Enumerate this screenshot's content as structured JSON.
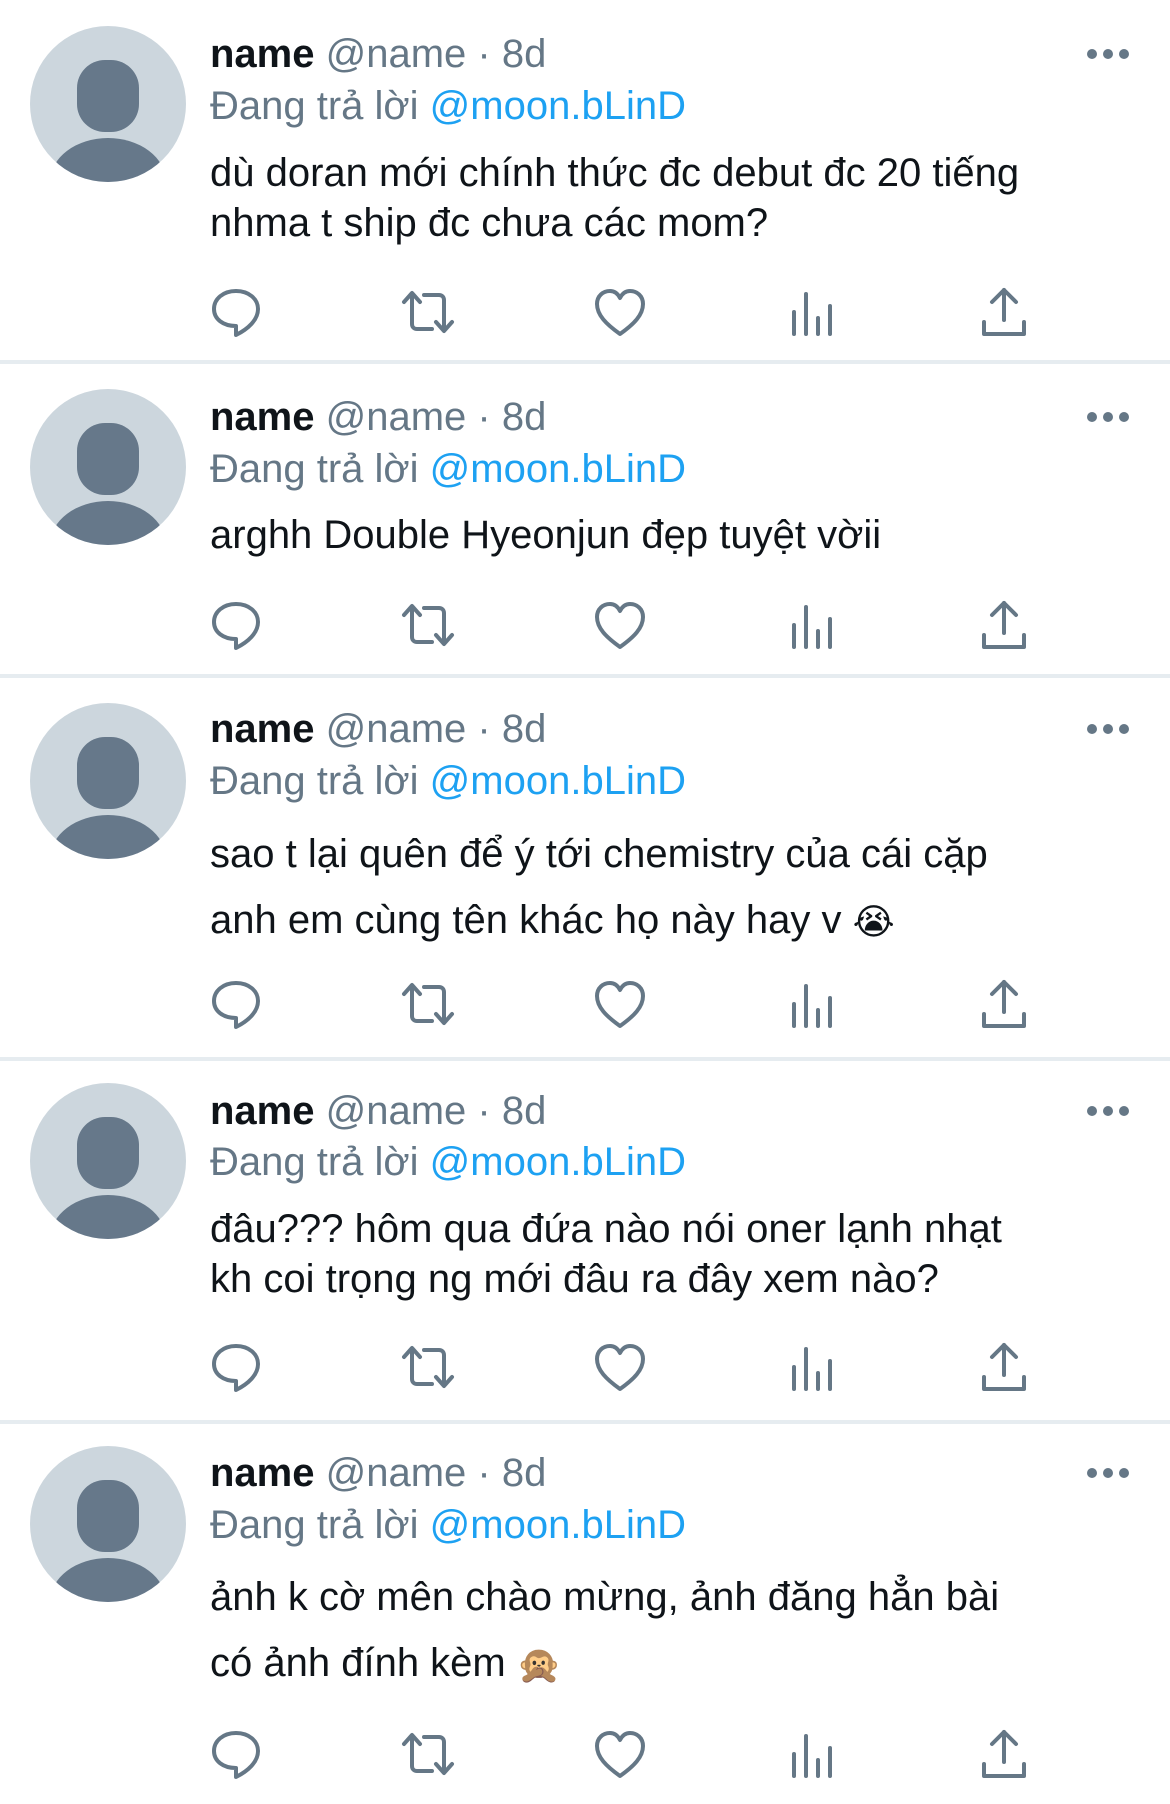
{
  "colors": {
    "text_primary": "#0f1419",
    "text_secondary": "#657786",
    "link": "#1da1f2",
    "divider": "#e6ecf0",
    "avatar_bg": "#ccd6dd",
    "avatar_fg": "#66788a"
  },
  "icons": {
    "more": "more-horizontal-icon",
    "reply": "reply-icon",
    "retweet": "retweet-icon",
    "like": "heart-icon",
    "views": "views-icon",
    "share": "share-icon"
  },
  "tweets": [
    {
      "author": "name",
      "handle": "@name",
      "separator": "·",
      "time": "8d",
      "reply_prefix": "Đang trả lời",
      "reply_mention": "@moon.bLinD",
      "lines": [
        "dù doran mới chính thức đc debut đc 20 tiếng",
        "nhma t ship đc chưa các mom?"
      ],
      "emoji": ""
    },
    {
      "author": "name",
      "handle": "@name",
      "separator": "·",
      "time": "8d",
      "reply_prefix": "Đang trả lời",
      "reply_mention": "@moon.bLinD",
      "lines": [
        "arghh Double Hyeonjun đẹp tuyệt vờii"
      ],
      "emoji": ""
    },
    {
      "author": "name",
      "handle": "@name",
      "separator": "·",
      "time": "8d",
      "reply_prefix": "Đang trả lời",
      "reply_mention": "@moon.bLinD",
      "lines": [
        "sao t lại quên để ý tới chemistry của cái cặp",
        "anh em cùng tên khác họ này hay v"
      ],
      "emoji": "😭"
    },
    {
      "author": "name",
      "handle": "@name",
      "separator": "·",
      "time": "8d",
      "reply_prefix": "Đang trả lời",
      "reply_mention": "@moon.bLinD",
      "lines": [
        "đâu??? hôm qua đứa nào nói oner lạnh nhạt",
        "kh coi trọng ng mới đâu ra đây xem nào?"
      ],
      "emoji": ""
    },
    {
      "author": "name",
      "handle": "@name",
      "separator": "·",
      "time": "8d",
      "reply_prefix": "Đang trả lời",
      "reply_mention": "@moon.bLinD",
      "lines": [
        "ảnh k cờ mên chào mừng, ảnh đăng hẳn bài",
        "có ảnh đính kèm"
      ],
      "emoji": "🙊"
    }
  ]
}
